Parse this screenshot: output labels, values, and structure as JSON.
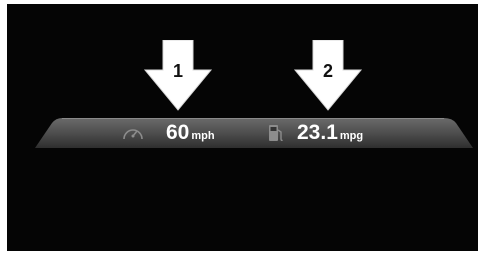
{
  "callouts": [
    {
      "number": "1"
    },
    {
      "number": "2"
    }
  ],
  "display": {
    "speed": {
      "value": "60",
      "unit": "mph",
      "icon": "speedometer-icon"
    },
    "economy": {
      "value": "23.1",
      "unit": "mpg",
      "icon": "fuel-pump-icon"
    }
  },
  "colors": {
    "background": "#050505",
    "bar": "#555555",
    "arrow": "#ffffff",
    "text": "#ffffff"
  }
}
